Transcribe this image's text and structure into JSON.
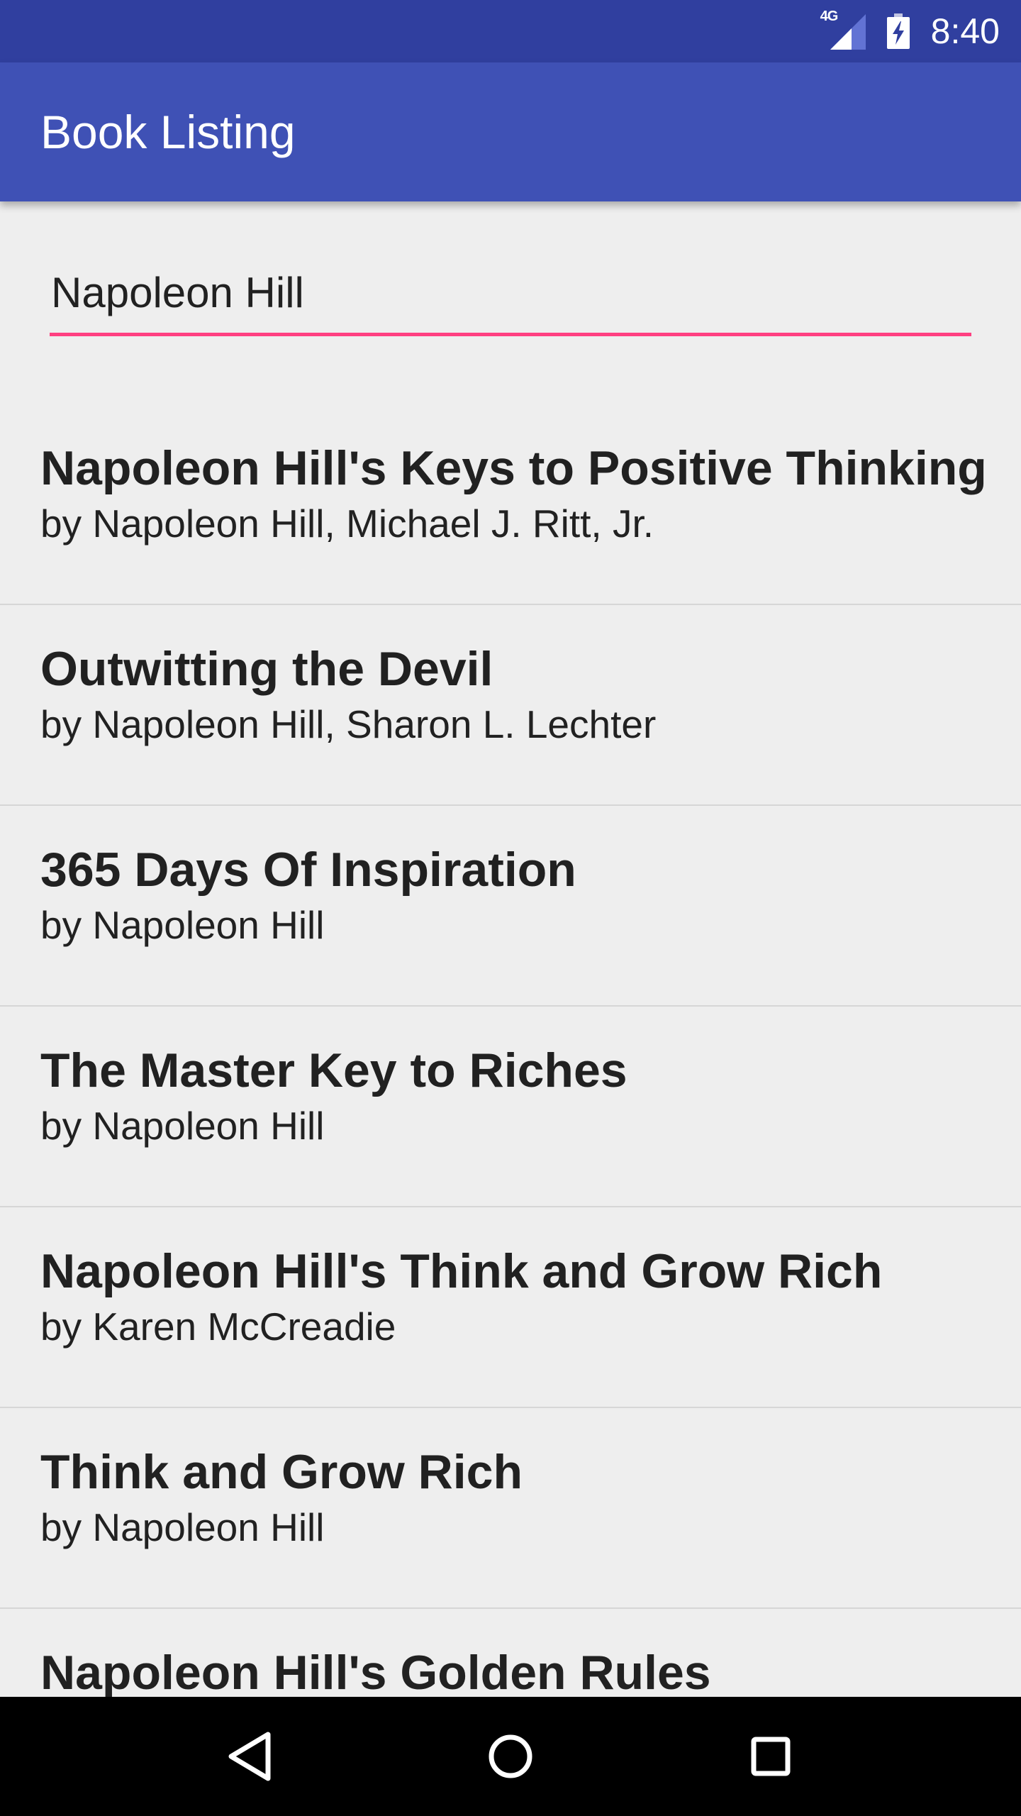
{
  "status_bar": {
    "network_label": "4G",
    "time": "8:40",
    "icons": [
      "signal-icon",
      "battery-charging-icon"
    ]
  },
  "app_bar": {
    "title": "Book Listing"
  },
  "search": {
    "value": "Napoleon Hill"
  },
  "books": [
    {
      "title": "Napoleon Hill's Keys to Positive Thinking",
      "author": "by Napoleon Hill, Michael J. Ritt, Jr."
    },
    {
      "title": "Outwitting the Devil",
      "author": "by Napoleon Hill, Sharon L. Lechter"
    },
    {
      "title": "365 Days Of Inspiration",
      "author": "by Napoleon Hill"
    },
    {
      "title": "The Master Key to Riches",
      "author": "by Napoleon Hill"
    },
    {
      "title": "Napoleon Hill's Think and Grow Rich",
      "author": "by Karen McCreadie"
    },
    {
      "title": "Think and Grow Rich",
      "author": "by Napoleon Hill"
    },
    {
      "title": "Napoleon Hill's Golden Rules",
      "author": ""
    }
  ],
  "nav_bar": {
    "icons": [
      "back-icon",
      "home-icon",
      "recents-icon"
    ]
  },
  "colors": {
    "status_bar": "#303F9F",
    "app_bar": "#3F51B5",
    "accent": "#FF4081",
    "background": "#EEEEEE"
  }
}
